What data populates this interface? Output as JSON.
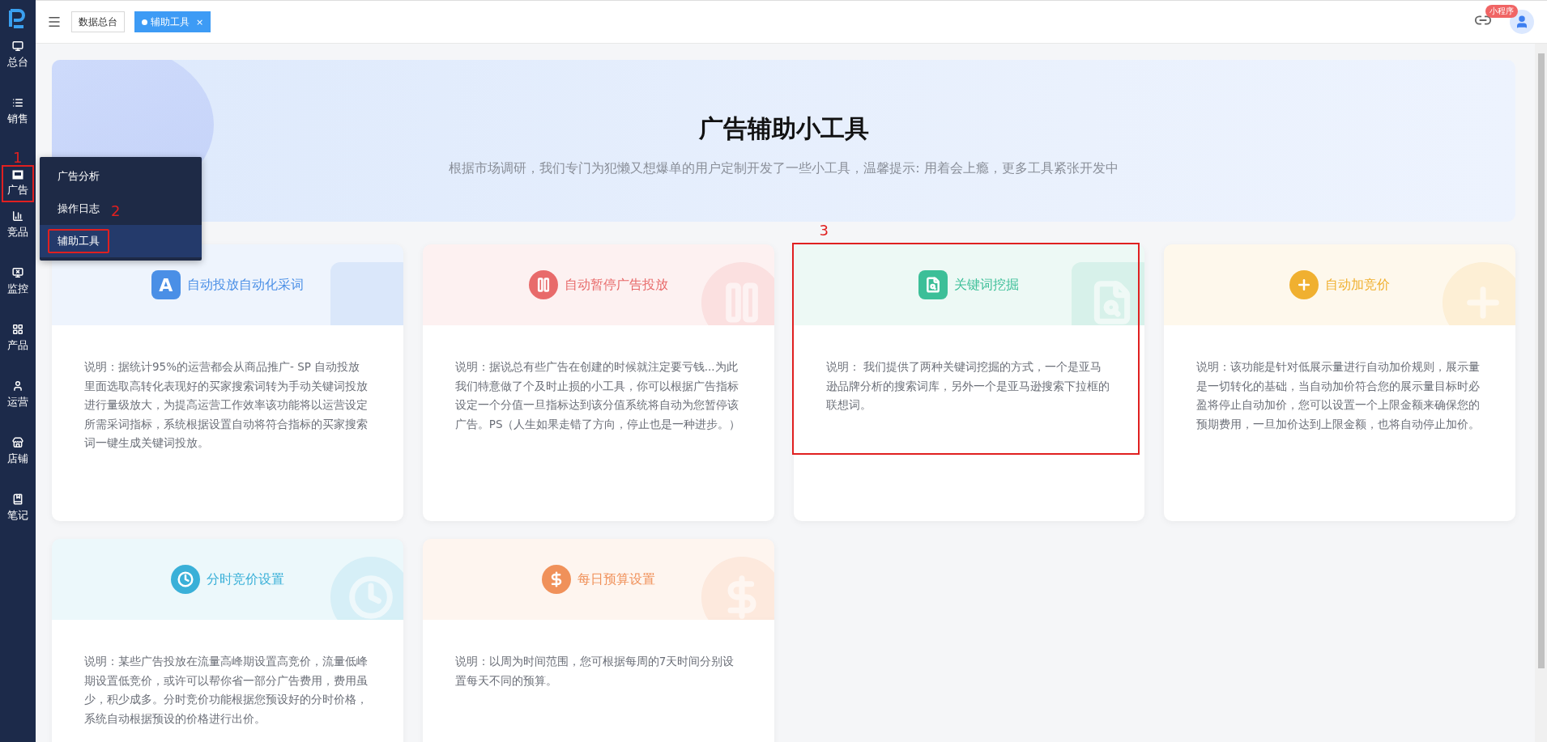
{
  "sidebar": {
    "items": [
      {
        "label": "总台"
      },
      {
        "label": "销售"
      },
      {
        "label": "广告",
        "annotation": "1"
      },
      {
        "label": "竞品"
      },
      {
        "label": "监控"
      },
      {
        "label": "产品"
      },
      {
        "label": "运营"
      },
      {
        "label": "店铺"
      },
      {
        "label": "笔记"
      }
    ]
  },
  "flyout_menu": {
    "items": [
      {
        "label": "广告分析",
        "selected": false
      },
      {
        "label": "操作日志",
        "selected": false,
        "annotation": "2"
      },
      {
        "label": "辅助工具",
        "selected": true,
        "marked": true
      }
    ]
  },
  "tabs": [
    {
      "label": "数据总台",
      "selected": false
    },
    {
      "label": "辅助工具",
      "selected": true,
      "close": "×"
    }
  ],
  "header_right": {
    "badge": "小程序"
  },
  "banner": {
    "title": "广告辅助小工具",
    "subtitle": "根据市场调研，我们专门为犯懒又想爆单的用户定制开发了一些小工具，温馨提示: 用着会上瘾，更多工具紧张开发中"
  },
  "tools": [
    {
      "kind": "letter",
      "glyph": "A",
      "title": "自动投放自动化采词",
      "color": "#4a8fe6",
      "description": "说明：据统计95%的运营都会从商品推广- SP 自动投放里面选取高转化表现好的买家搜索词转为手动关键词投放进行量级放大，为提高运营工作效率该功能将以运营设定所需采词指标，系统根据设置自动将符合指标的买家搜索词一键生成关键词投放。"
    },
    {
      "kind": "pause",
      "title": "自动暂停广告投放",
      "color": "#e86b6b",
      "description": "说明：据说总有些广告在创建的时候就注定要亏钱...为此我们特意做了个及时止损的小工具，你可以根据广告指标设定一个分值一旦指标达到该分值系统将自动为您暂停该广告。PS（人生如果走错了方向，停止也是一种进步。）"
    },
    {
      "kind": "search",
      "title": "关键词挖掘",
      "color": "#3cbf98",
      "annotation": "3",
      "description": "说明： 我们提供了两种关键词挖掘的方式，一个是亚马逊品牌分析的搜索词库，另外一个是亚马逊搜索下拉框的联想词。"
    },
    {
      "kind": "plus",
      "title": "自动加竞价",
      "color": "#f0b030",
      "description": "说明：该功能是针对低展示量进行自动加价规则，展示量是一切转化的基础，当自动加价符合您的展示量目标时必盈将停止自动加价，您可以设置一个上限金额来确保您的预期费用，一旦加价达到上限金额，也将自动停止加价。"
    },
    {
      "kind": "clock",
      "title": "分时竞价设置",
      "color": "#3ab0d8",
      "description": "说明：某些广告投放在流量高峰期设置高竞价，流量低峰期设置低竞价，或许可以帮你省一部分广告费用，费用虽少，积少成多。分时竞价功能根据您预设好的分时价格，系统自动根据预设的价格进行出价。"
    },
    {
      "kind": "dollar",
      "title": "每日预算设置",
      "color": "#f0915a",
      "description": "说明：以周为时间范围，您可根据每周的7天时间分别设置每天不同的预算。"
    }
  ]
}
